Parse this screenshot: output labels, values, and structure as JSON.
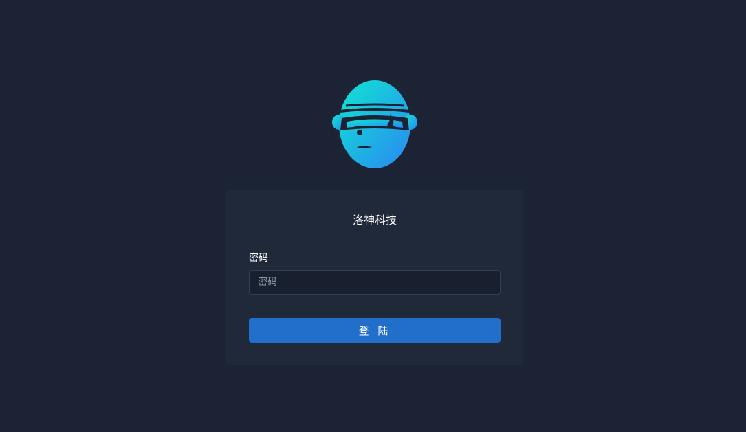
{
  "logo": {
    "icon": "ninja-mascot-icon",
    "gradient": [
      "#11e3d4",
      "#2a8df0"
    ]
  },
  "card": {
    "title": "洛神科技",
    "password": {
      "label": "密码",
      "placeholder": "密码",
      "value": ""
    },
    "login_button": "登 陆"
  },
  "colors": {
    "background": "#1b2334",
    "card": "#1f293a",
    "accent": "#226ecb"
  }
}
